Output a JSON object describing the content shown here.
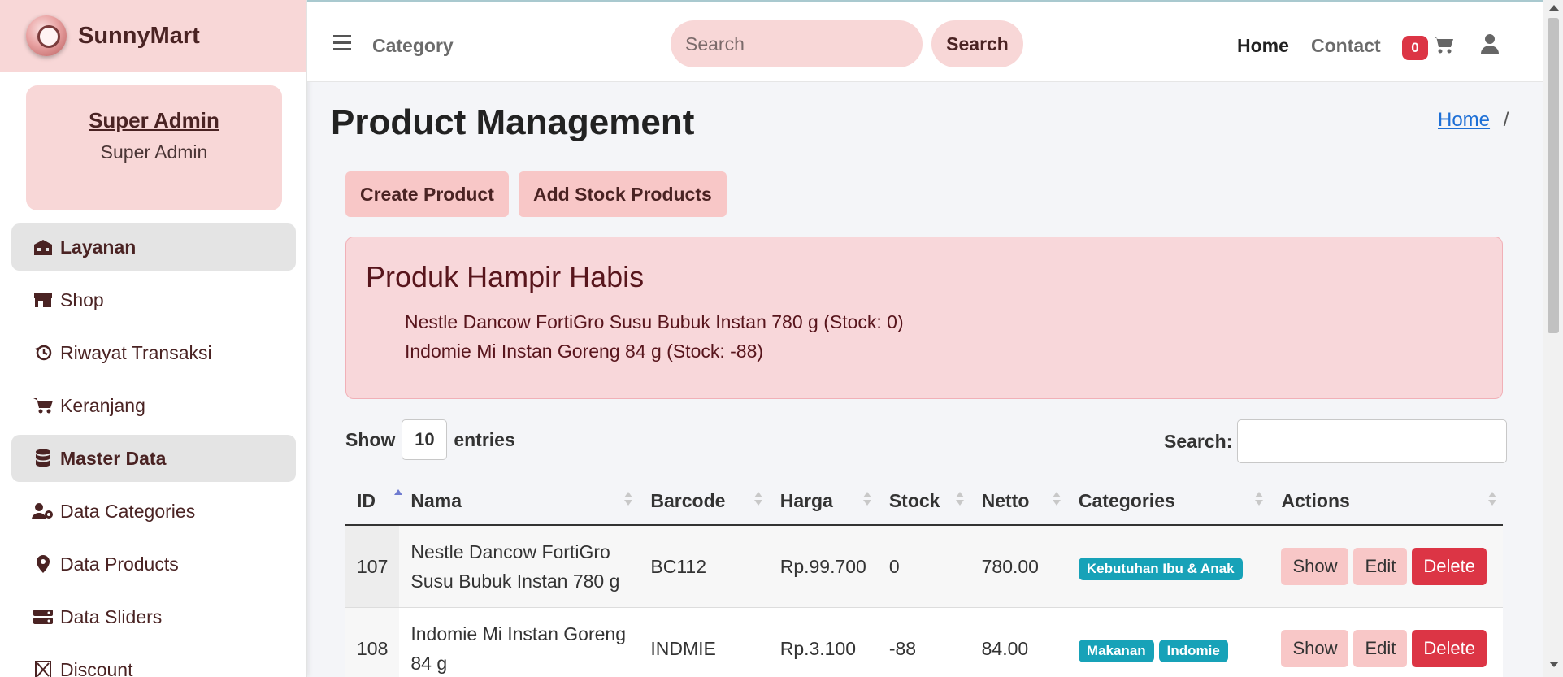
{
  "brand": {
    "name": "SunnyMart"
  },
  "user": {
    "name": "Super Admin",
    "role": "Super Admin"
  },
  "sidebar": {
    "items": [
      {
        "label": "Layanan",
        "icon": "building-icon",
        "header": true
      },
      {
        "label": "Shop",
        "icon": "store-icon",
        "header": false
      },
      {
        "label": "Riwayat Transaksi",
        "icon": "history-icon",
        "header": false
      },
      {
        "label": "Keranjang",
        "icon": "cart-icon",
        "header": false
      },
      {
        "label": "Master Data",
        "icon": "database-icon",
        "header": true
      },
      {
        "label": "Data Categories",
        "icon": "user-gear-icon",
        "header": false
      },
      {
        "label": "Data Products",
        "icon": "map-pin-icon",
        "header": false
      },
      {
        "label": "Data Sliders",
        "icon": "server-icon",
        "header": false
      },
      {
        "label": "Discount",
        "icon": "discount-icon",
        "header": false
      }
    ]
  },
  "topbar": {
    "category_label": "Category",
    "search_placeholder": "Search",
    "search_button": "Search",
    "home_label": "Home",
    "contact_label": "Contact",
    "cart_count": "0"
  },
  "page": {
    "title": "Product Management",
    "breadcrumb_home": "Home",
    "breadcrumb_sep": "/",
    "create_button": "Create Product",
    "add_stock_button": "Add Stock Products"
  },
  "alert": {
    "title": "Produk Hampir Habis",
    "items": [
      "Nestle Dancow FortiGro Susu Bubuk Instan 780 g (Stock: 0)",
      "Indomie Mi Instan Goreng 84 g (Stock: -88)"
    ]
  },
  "table_controls": {
    "show_label": "Show",
    "entries_value": "10",
    "entries_label": "entries",
    "search_label": "Search:"
  },
  "table": {
    "headers": [
      "ID",
      "Nama",
      "Barcode",
      "Harga",
      "Stock",
      "Netto",
      "Categories",
      "Actions"
    ],
    "rows": [
      {
        "id": "107",
        "name": "Nestle Dancow FortiGro Susu Bubuk Instan 780 g",
        "barcode": "BC112",
        "price": "Rp.99.700",
        "stock": "0",
        "netto": "780.00",
        "categories": [
          "Kebutuhan Ibu & Anak"
        ]
      },
      {
        "id": "108",
        "name": "Indomie Mi Instan Goreng 84 g",
        "barcode": "INDMIE",
        "price": "Rp.3.100",
        "stock": "-88",
        "netto": "84.00",
        "categories": [
          "Makanan",
          "Indomie"
        ]
      }
    ],
    "actions": {
      "show": "Show",
      "edit": "Edit",
      "delete": "Delete"
    }
  },
  "colors": {
    "brand_pink": "#f8d7d7",
    "button_pink": "#f8c7c7",
    "danger": "#dc3545",
    "badge_info": "#17a2b8",
    "alert_bg": "#f8d7da",
    "link_blue": "#1d6fd6"
  }
}
